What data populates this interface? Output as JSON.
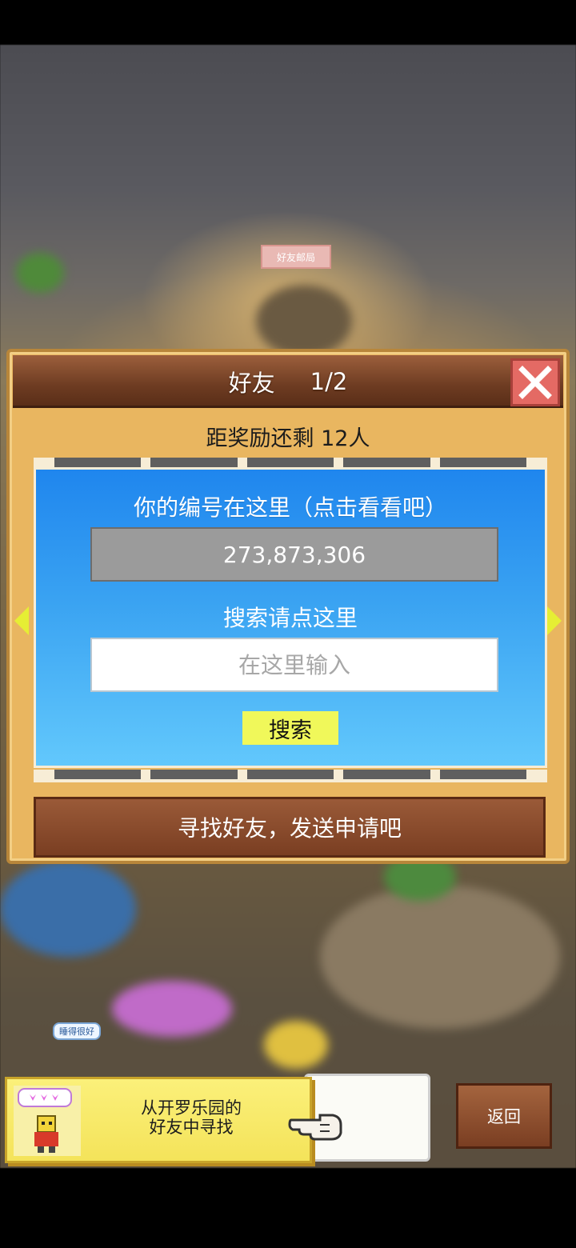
{
  "map": {
    "post_office_label": "好友邮局",
    "npc_bubble": "睡得很好"
  },
  "dialog": {
    "title": "好友",
    "page": "1/2",
    "reward_text": "距奖励还剩 12人",
    "id_label": "你的编号在这里（点击看看吧）",
    "player_id": "273,873,306",
    "search_label": "搜索请点这里",
    "search_placeholder": "在这里输入",
    "search_button": "搜索",
    "find_friends_button": "寻找好友，发送申请吧"
  },
  "hint": {
    "line1": "从开罗乐园的",
    "line2": "好友中寻找"
  },
  "back_button": "返回",
  "colors": {
    "panel_blue": "#3aa3f2",
    "close_red": "#e46a64",
    "button_yellow": "#f0f85a",
    "header_brown": "#6e3c22"
  }
}
